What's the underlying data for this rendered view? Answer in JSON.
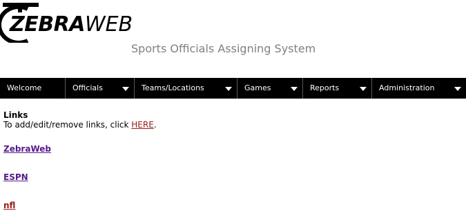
{
  "logo": {
    "brand_bold": "ZEBRA",
    "brand_light": "WEB"
  },
  "header": {
    "subtitle": "Sports Officials Assigning System"
  },
  "nav": {
    "items": [
      {
        "label": "Welcome",
        "has_dropdown": false
      },
      {
        "label": "Officials",
        "has_dropdown": true
      },
      {
        "label": "Teams/Locations",
        "has_dropdown": true
      },
      {
        "label": "Games",
        "has_dropdown": true
      },
      {
        "label": "Reports",
        "has_dropdown": true
      },
      {
        "label": "Administration",
        "has_dropdown": true
      }
    ]
  },
  "links_section": {
    "heading": "Links",
    "instructions_prefix": "To add/edit/remove links, click ",
    "here_label": "HERE",
    "instructions_suffix": ".",
    "links": [
      {
        "label": "ZebraWeb"
      },
      {
        "label": "ESPN"
      },
      {
        "label": "nfl"
      }
    ]
  },
  "colors": {
    "nav_background": "#000000",
    "subtitle_text": "#808080",
    "visited_link": "#551a8b",
    "active_link": "#9b1b1b"
  }
}
